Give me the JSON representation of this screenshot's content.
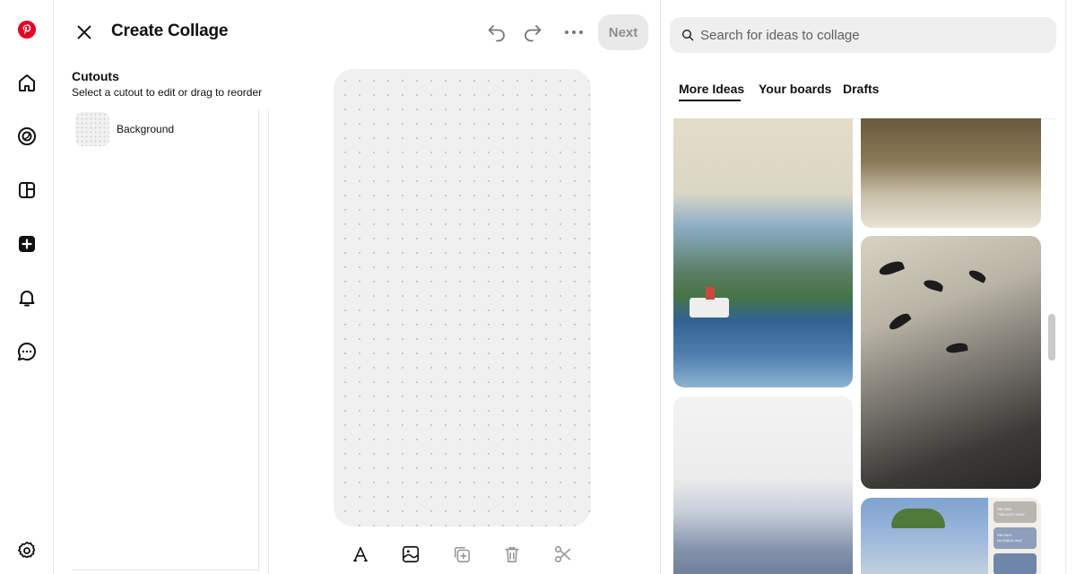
{
  "rail": {
    "icons": [
      "pinterest-logo-icon",
      "home-icon",
      "explore-icon",
      "board-icon",
      "create-icon",
      "notifications-icon",
      "messages-icon",
      "settings-icon"
    ],
    "brand_color": "#e60023"
  },
  "header": {
    "title": "Create Collage",
    "next_label": "Next"
  },
  "cutouts": {
    "title": "Cutouts",
    "subtitle": "Select a cutout to edit or drag to reorder",
    "items": [
      {
        "label": "Background"
      }
    ]
  },
  "toolbar": {
    "tools": [
      "text-tool-icon",
      "image-tool-icon",
      "add-layer-icon",
      "trash-icon",
      "scissors-icon"
    ]
  },
  "search": {
    "placeholder": "Search for ideas to collage"
  },
  "tabs": [
    {
      "label": "More Ideas",
      "active": true
    },
    {
      "label": "Your boards",
      "active": false
    },
    {
      "label": "Drafts",
      "active": false
    }
  ],
  "pins": [
    {
      "name": "pin-map-lighthouse"
    },
    {
      "name": "pin-branch"
    },
    {
      "name": "pin-birds-collage"
    },
    {
      "name": "pin-gradient"
    },
    {
      "name": "pin-monet-palette",
      "swatches": [
        {
          "code": "SW 9654",
          "name": "TWILIGHT GRAY",
          "color": "#b9b6b0"
        },
        {
          "code": "SW 6521",
          "name": "NOTABLE HUE",
          "color": "#8e9fbc"
        },
        {
          "code": "",
          "name": "",
          "color": "#6f86ab"
        }
      ]
    }
  ]
}
